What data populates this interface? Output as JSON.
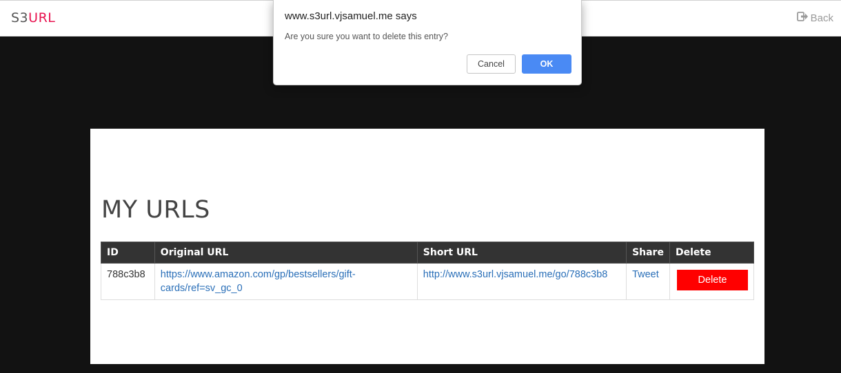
{
  "navbar": {
    "brand_prefix": "S3",
    "brand_suffix": "URL",
    "back_label": "Back"
  },
  "main": {
    "title": "MY URLS",
    "table": {
      "headers": [
        "ID",
        "Original URL",
        "Short URL",
        "Share",
        "Delete"
      ],
      "rows": [
        {
          "id": "788c3b8",
          "original_url": "https://www.amazon.com/gp/bestsellers/gift-cards/ref=sv_gc_0",
          "short_url": "http://www.s3url.vjsamuel.me/go/788c3b8",
          "share_label": "Tweet",
          "delete_label": "Delete"
        }
      ]
    }
  },
  "dialog": {
    "title": "www.s3url.vjsamuel.me says",
    "message": "Are you sure you want to delete this entry?",
    "cancel_label": "Cancel",
    "ok_label": "OK"
  },
  "colors": {
    "brand_accent": "#e8124f",
    "delete_button": "#ff0000",
    "ok_button": "#4a8af4",
    "link": "#2a6fb8",
    "background": "#121212"
  },
  "icons": {
    "back": "sign-out-icon"
  }
}
